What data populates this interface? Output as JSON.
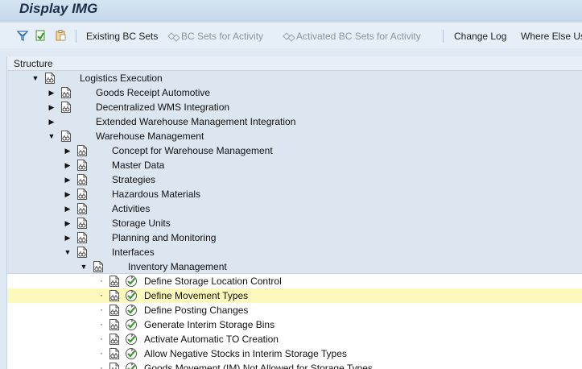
{
  "window": {
    "title": "Display IMG"
  },
  "toolbar": {
    "existing_bc_sets": "Existing BC Sets",
    "bc_sets_for_activity": "BC Sets for Activity",
    "activated_bc_sets_for_activity": "Activated BC Sets for Activity",
    "change_log": "Change Log",
    "where_else_used": "Where Else Us"
  },
  "structure": {
    "header": "Structure",
    "rows": [
      {
        "label": "Logistics Execution",
        "expander": "expanded",
        "level": 0,
        "icon": "structure-node-icon",
        "exec": false,
        "style": "blue"
      },
      {
        "label": "Goods Receipt Automotive",
        "expander": "collapsed",
        "level": 1,
        "icon": "structure-node-icon",
        "exec": false,
        "style": "blue"
      },
      {
        "label": "Decentralized WMS Integration",
        "expander": "collapsed",
        "level": 1,
        "icon": "structure-node-icon",
        "exec": false,
        "style": "blue"
      },
      {
        "label": "Extended Warehouse Management Integration",
        "expander": "collapsed",
        "level": 1,
        "icon": "",
        "exec": false,
        "style": "blue"
      },
      {
        "label": "Warehouse Management",
        "expander": "expanded",
        "level": 1,
        "icon": "structure-node-icon",
        "exec": false,
        "style": "blue"
      },
      {
        "label": "Concept for Warehouse Management",
        "expander": "collapsed",
        "level": 2,
        "icon": "structure-node-icon",
        "exec": false,
        "style": "blue"
      },
      {
        "label": "Master Data",
        "expander": "collapsed",
        "level": 2,
        "icon": "structure-node-icon",
        "exec": false,
        "style": "blue"
      },
      {
        "label": "Strategies",
        "expander": "collapsed",
        "level": 2,
        "icon": "structure-node-icon",
        "exec": false,
        "style": "blue"
      },
      {
        "label": "Hazardous Materials",
        "expander": "collapsed",
        "level": 2,
        "icon": "structure-node-icon",
        "exec": false,
        "style": "blue"
      },
      {
        "label": "Activities",
        "expander": "collapsed",
        "level": 2,
        "icon": "structure-node-icon",
        "exec": false,
        "style": "blue"
      },
      {
        "label": "Storage Units",
        "expander": "collapsed",
        "level": 2,
        "icon": "structure-node-icon",
        "exec": false,
        "style": "blue"
      },
      {
        "label": "Planning and Monitoring",
        "expander": "collapsed",
        "level": 2,
        "icon": "structure-node-icon",
        "exec": false,
        "style": "blue"
      },
      {
        "label": "Interfaces",
        "expander": "expanded",
        "level": 2,
        "icon": "structure-node-icon",
        "exec": false,
        "style": "blue"
      },
      {
        "label": "Inventory Management",
        "expander": "expanded",
        "level": 3,
        "icon": "structure-node-icon",
        "exec": false,
        "style": "blue"
      },
      {
        "label": "Define Storage Location Control",
        "expander": "leaf",
        "level": 4,
        "icon": "structure-node-icon",
        "exec": true,
        "style": "white"
      },
      {
        "label": "Define Movement Types",
        "expander": "leaf",
        "level": 4,
        "icon": "structure-node-icon",
        "exec": true,
        "style": "sel"
      },
      {
        "label": "Define Posting Changes",
        "expander": "leaf",
        "level": 4,
        "icon": "structure-node-icon",
        "exec": true,
        "style": "white"
      },
      {
        "label": "Generate Interim Storage Bins",
        "expander": "leaf",
        "level": 4,
        "icon": "structure-node-icon",
        "exec": true,
        "style": "white"
      },
      {
        "label": "Activate Automatic TO Creation",
        "expander": "leaf",
        "level": 4,
        "icon": "structure-node-icon",
        "exec": true,
        "style": "white"
      },
      {
        "label": "Allow Negative Stocks in Interim Storage Types",
        "expander": "leaf",
        "level": 4,
        "icon": "structure-node-icon",
        "exec": true,
        "style": "white"
      },
      {
        "label": "Goods Movement (IM) Not Allowed for Storage Types",
        "expander": "leaf",
        "level": 4,
        "icon": "structure-node-icon",
        "exec": true,
        "style": "white"
      }
    ]
  },
  "colors": {
    "title_text": "#1a2e48",
    "tree_blue": "#dce6f1",
    "selected_row": "#fdf9bd",
    "exec_icon_green": "#3c9a2e"
  }
}
